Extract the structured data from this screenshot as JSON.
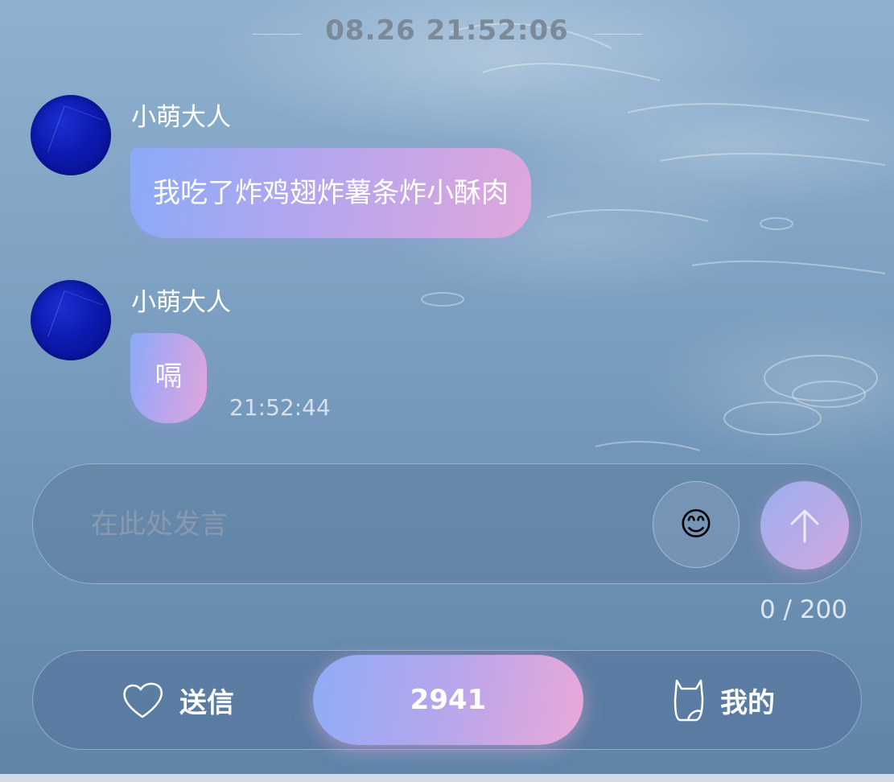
{
  "header": {
    "timestamp": "08.26 21:52:06"
  },
  "messages": [
    {
      "sender": "小萌大人",
      "text": "我吃了炸鸡翅炸薯条炸小酥肉",
      "time": ""
    },
    {
      "sender": "小萌大人",
      "text": "嗝",
      "time": "21:52:44"
    }
  ],
  "composer": {
    "placeholder": "在此处发言",
    "value": "",
    "emoji": "😊",
    "emoji_icon": "smiley-face-icon",
    "send_icon": "arrow-up-icon",
    "char_count": "0 / 200"
  },
  "nav": {
    "letter_label": "送信",
    "letter_icon": "heart-outline-icon",
    "center_value": "2941",
    "mine_label": "我的",
    "mine_icon": "cat-outline-icon"
  },
  "colors": {
    "bubble_start": "#8aaaf8",
    "bubble_end": "#e0a6dc",
    "avatar": "#0d1ab0",
    "background": "#7fa2c3"
  }
}
